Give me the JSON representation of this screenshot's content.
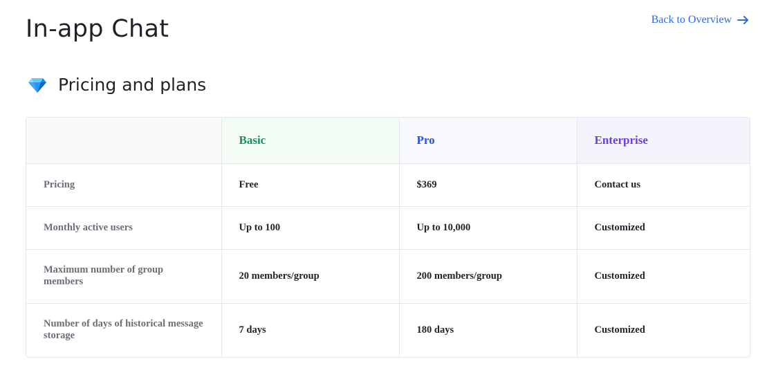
{
  "header": {
    "title": "In-app Chat",
    "back_link": "Back to Overview"
  },
  "section": {
    "icon": "diamond-icon",
    "title": "Pricing and plans"
  },
  "table": {
    "columns": [
      "",
      "Basic",
      "Pro",
      "Enterprise"
    ],
    "rows": [
      {
        "label": "Pricing",
        "basic": "Free",
        "pro": "$369",
        "enterprise": "Contact us"
      },
      {
        "label": "Monthly active users",
        "basic": "Up to 100",
        "pro": "Up to 10,000",
        "enterprise": "Customized"
      },
      {
        "label": "Maximum number of group members",
        "basic": "20 members/group",
        "pro": "200 members/group",
        "enterprise": "Customized"
      },
      {
        "label": "Number of days of historical message storage",
        "basic": "7 days",
        "pro": "180 days",
        "enterprise": "Customized"
      }
    ]
  },
  "colors": {
    "basic": "#16915a",
    "pro": "#2b4ee0",
    "enterprise": "#6a3ee0",
    "link": "#2b6be6"
  }
}
